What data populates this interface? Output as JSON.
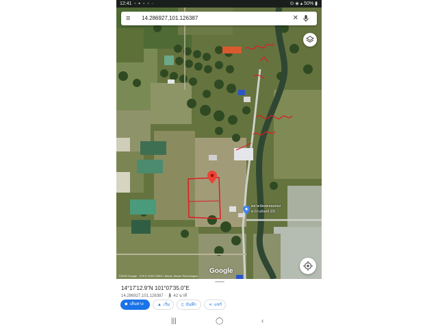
{
  "status_bar": {
    "time": "12:41",
    "battery": "50%"
  },
  "search": {
    "query": "14.286927,101.126387"
  },
  "map": {
    "copyright": "©2020 Google · ภาพ © 2020 CNES / Airbus, Maxar Technologies",
    "logo": "Google",
    "place_label_1": "ตลาดนัดสดจอมทอง",
    "place_label_2": "ต.บ้านจันทร์ 2/3"
  },
  "place_sheet": {
    "coordinates_dms": "14°17'12.9\"N 101°07'35.0\"E",
    "coordinates_decimal": "14.286927,101.126387",
    "travel_time": "42 นาที"
  },
  "actions": {
    "directions": "เส้นทาง",
    "start": "เริ่ม",
    "save": "บันทึก",
    "share": "แชร์"
  },
  "icons": {
    "menu": "hamburger-icon",
    "clear": "close-icon",
    "mic": "microphone-icon",
    "layers": "layers-icon",
    "locate": "my-location-icon",
    "pin": "map-pin-icon",
    "walk": "walking-icon"
  },
  "colors": {
    "accent": "#1a73e8",
    "pin": "#ea4335",
    "annotation": "#e01b24"
  }
}
